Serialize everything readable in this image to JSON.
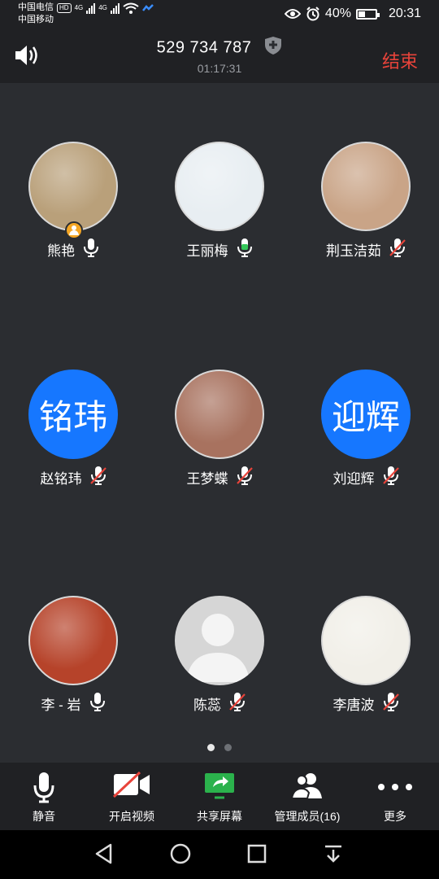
{
  "status_bar": {
    "carrier1": "中国电信",
    "carrier1_badge": "HD",
    "carrier2": "中国移动",
    "net1": "4G",
    "net2": "4G",
    "battery": "40%",
    "battery_level": 0.4,
    "time": "20:31"
  },
  "header": {
    "meeting_id": "529 734 787",
    "timer": "01:17:31",
    "end_label": "结束"
  },
  "participants": [
    {
      "name": "熊艳",
      "avatar_type": "photo",
      "photo_tone": "#b9a07a",
      "mic": "on",
      "host": true
    },
    {
      "name": "王丽梅",
      "avatar_type": "photo",
      "photo_tone": "#e8eef2",
      "mic": "speaking",
      "host": false
    },
    {
      "name": "荆玉洁茹",
      "avatar_type": "photo",
      "photo_tone": "#c9a487",
      "mic": "muted",
      "host": false
    },
    {
      "name": "赵铭玮",
      "avatar_type": "text",
      "avatar_text": "铭玮",
      "mic": "muted",
      "host": false
    },
    {
      "name": "王梦蝶",
      "avatar_type": "photo",
      "photo_tone": "#a8725f",
      "mic": "muted",
      "host": false
    },
    {
      "name": "刘迎辉",
      "avatar_type": "text",
      "avatar_text": "迎辉",
      "mic": "muted",
      "host": false
    },
    {
      "name": "李 - 岩",
      "avatar_type": "photo",
      "photo_tone": "#b6432a",
      "mic": "on",
      "host": false
    },
    {
      "name": "陈蕊",
      "avatar_type": "default",
      "mic": "muted",
      "host": false
    },
    {
      "name": "李唐波",
      "avatar_type": "photo",
      "photo_tone": "#f1efe8",
      "mic": "muted",
      "host": false
    }
  ],
  "pager": {
    "pages": 2,
    "current": 1
  },
  "toolbar": {
    "mute_label": "静音",
    "video_label": "开启视频",
    "share_label": "共享屏幕",
    "members_label": "管理成员(16)",
    "more_label": "更多"
  },
  "colors": {
    "accent_blue": "#1677ff",
    "end_red": "#e8433a",
    "speaking_green": "#34c759",
    "muted_red": "#e8433a",
    "share_green": "#2bb24c"
  }
}
